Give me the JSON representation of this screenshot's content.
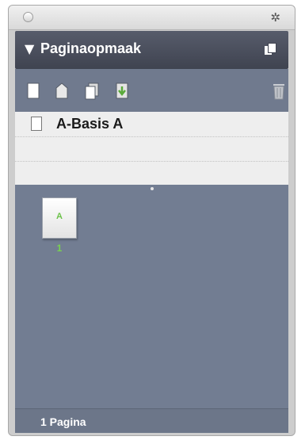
{
  "panel": {
    "title": "Paginaopmaak",
    "collapse_glyph": "▼",
    "gear_glyph": "✲",
    "icons": {
      "close": "window-close-icon",
      "gear": "gear-icon",
      "menu": "panel-menu-icon"
    }
  },
  "toolbar": {
    "buttons": [
      {
        "name": "blank-page-icon",
        "tooltip": ""
      },
      {
        "name": "master-page-icon",
        "tooltip": ""
      },
      {
        "name": "duplicate-page-icon",
        "tooltip": ""
      },
      {
        "name": "load-master-icon",
        "tooltip": ""
      },
      {
        "name": "trash-icon",
        "tooltip": ""
      }
    ]
  },
  "masters": {
    "items": [
      {
        "label": "A-Basis A"
      }
    ]
  },
  "pages": {
    "thumbnail_label": "A",
    "page_number": "1"
  },
  "status": {
    "count_text": "1 Pagina"
  },
  "colors": {
    "header_bg": "#3f4350",
    "toolbar_bg": "#707a8e",
    "pages_bg": "#727d92",
    "list_bg": "#eeeeee",
    "page_number_green": "#78d24f"
  }
}
